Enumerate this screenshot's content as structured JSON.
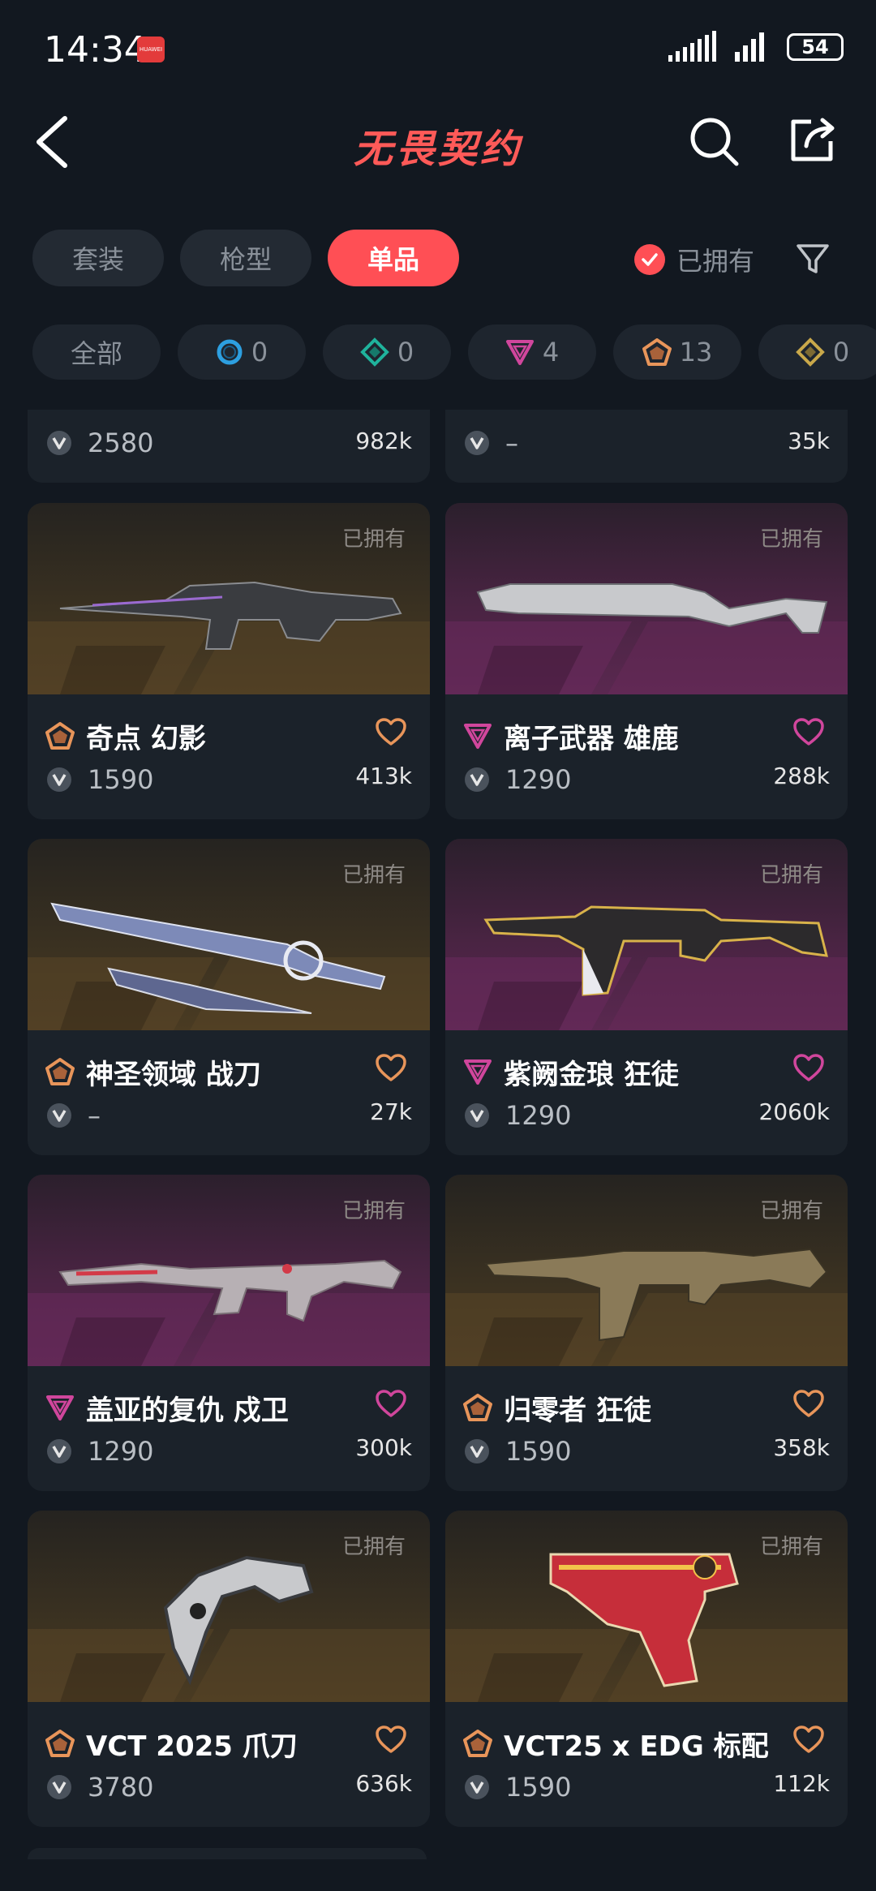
{
  "status": {
    "time": "14:34",
    "app_badge": "HUAWEI",
    "battery": "54"
  },
  "header": {
    "title": "无畏契约"
  },
  "tabs": [
    {
      "label": "套装",
      "active": false
    },
    {
      "label": "枪型",
      "active": false
    },
    {
      "label": "单品",
      "active": true
    }
  ],
  "owned_filter": {
    "label": "已拥有",
    "checked": true
  },
  "rarity_chips": [
    {
      "label": "全部"
    },
    {
      "count": "0",
      "tier": "select",
      "color": "#2d9fe0"
    },
    {
      "count": "0",
      "tier": "deluxe",
      "color": "#1fb39c"
    },
    {
      "count": "4",
      "tier": "premium",
      "color": "#d0469c"
    },
    {
      "count": "13",
      "tier": "exclusive",
      "color": "#e8955a"
    },
    {
      "count": "0",
      "tier": "ultra",
      "color": "#c9a84a"
    }
  ],
  "partial_row": [
    {
      "price": "2580",
      "likes": "982k"
    },
    {
      "price": "–",
      "likes": "35k"
    }
  ],
  "cards": [
    {
      "owned": "已拥有",
      "name": "奇点 幻影",
      "price": "1590",
      "likes": "413k",
      "tier": "exclusive",
      "bg": "gold"
    },
    {
      "owned": "已拥有",
      "name": "离子武器 雄鹿",
      "price": "1290",
      "likes": "288k",
      "tier": "premium",
      "bg": "purple"
    },
    {
      "owned": "已拥有",
      "name": "神圣领域 战刀",
      "price": "–",
      "likes": "27k",
      "tier": "exclusive",
      "bg": "gold"
    },
    {
      "owned": "已拥有",
      "name": "紫阙金琅 狂徒",
      "price": "1290",
      "likes": "2060k",
      "tier": "premium",
      "bg": "purple"
    },
    {
      "owned": "已拥有",
      "name": "盖亚的复仇 戍卫",
      "price": "1290",
      "likes": "300k",
      "tier": "premium",
      "bg": "purple"
    },
    {
      "owned": "已拥有",
      "name": "归零者 狂徒",
      "price": "1590",
      "likes": "358k",
      "tier": "exclusive",
      "bg": "gold"
    },
    {
      "owned": "已拥有",
      "name": "VCT 2025 爪刀",
      "price": "3780",
      "likes": "636k",
      "tier": "exclusive",
      "bg": "gold"
    },
    {
      "owned": "已拥有",
      "name": "VCT25 x EDG 标配",
      "price": "1590",
      "likes": "112k",
      "tier": "exclusive",
      "bg": "gold"
    }
  ],
  "colors": {
    "accent": "#ff4f55",
    "exclusive": "#e8955a",
    "premium": "#d0469c"
  }
}
